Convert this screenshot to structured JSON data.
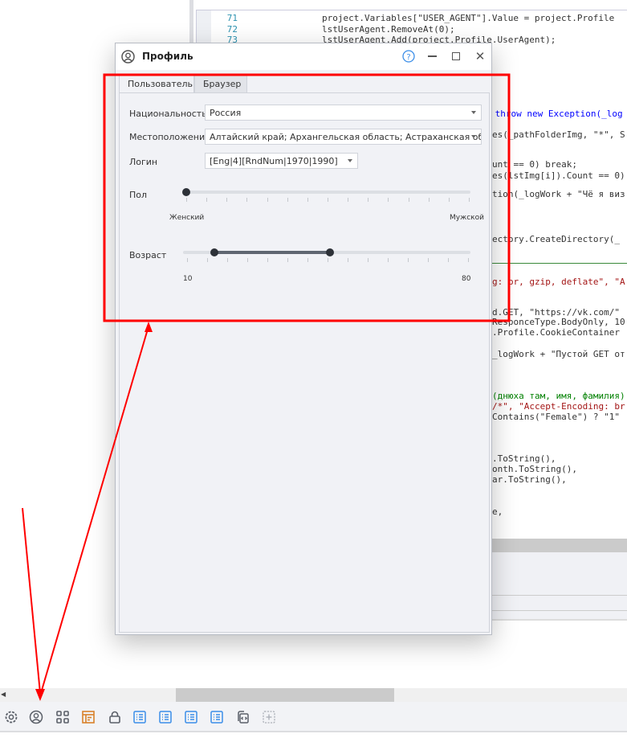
{
  "editor": {
    "lines": [
      {
        "n": "71",
        "code": "project.Variables[\"USER_AGENT\"].Value = project.Profile"
      },
      {
        "n": "72",
        "code": "lstUserAgent.RemoveAt(0);"
      },
      {
        "n": "73",
        "code": "lstUserAgent.Add(project.Profile.UserAgent);"
      }
    ],
    "fragments": [
      " throw new Exception(_log",
      "es(_pathFolderImg, \"*\", S",
      "unt == 0) break;",
      "es(lstImg[i]).Count == 0)",
      "tion(_logWork + \"Чё я виз",
      "ectory.CreateDirectory(_",
      "g: br, gzip, deflate\", \"A",
      "d.GET, \"https://vk.com/\"",
      "ResponceType.BodyOnly, 10",
      ".Profile.CookieContainer",
      "_logWork + \"Пустой GET от",
      "(днюха там, имя, фамилия)",
      "/*\", \"Accept-Encoding: br",
      "Contains(\"Female\") ? \"1\"",
      ".ToString(),",
      "onth.ToString(),",
      "ar.ToString(),",
      "e,"
    ]
  },
  "dialog": {
    "title": "Профиль",
    "tabs": [
      "Пользователь",
      "Браузер"
    ],
    "active_tab": "Пользователь",
    "nationality": {
      "label": "Национальность",
      "value": "Россия"
    },
    "location": {
      "label": "Местоположение",
      "value": "Алтайский край; Архангельская область; Астраханская обл..."
    },
    "login": {
      "label": "Логин",
      "value": "[Eng|4][RndNum|1970|1990]"
    },
    "gender": {
      "label": "Пол",
      "min_label": "Женский",
      "max_label": "Мужской",
      "value": 0
    },
    "age": {
      "label": "Возраст",
      "min_label": "10",
      "max_label": "80",
      "range_low": 0.11,
      "range_high": 0.51
    }
  },
  "accent": {
    "annotation": "#ff0000",
    "help": "#3b8ee8",
    "toolbar_orange": "#d9822b",
    "toolbar_blue": "#3b8ee8"
  },
  "toolbar": [
    "settings-icon",
    "profile-icon",
    "grid-icon",
    "layout-icon",
    "lock-icon",
    "list-icon",
    "list-icon",
    "list-icon",
    "list-icon",
    "files-icon",
    "add-icon"
  ]
}
